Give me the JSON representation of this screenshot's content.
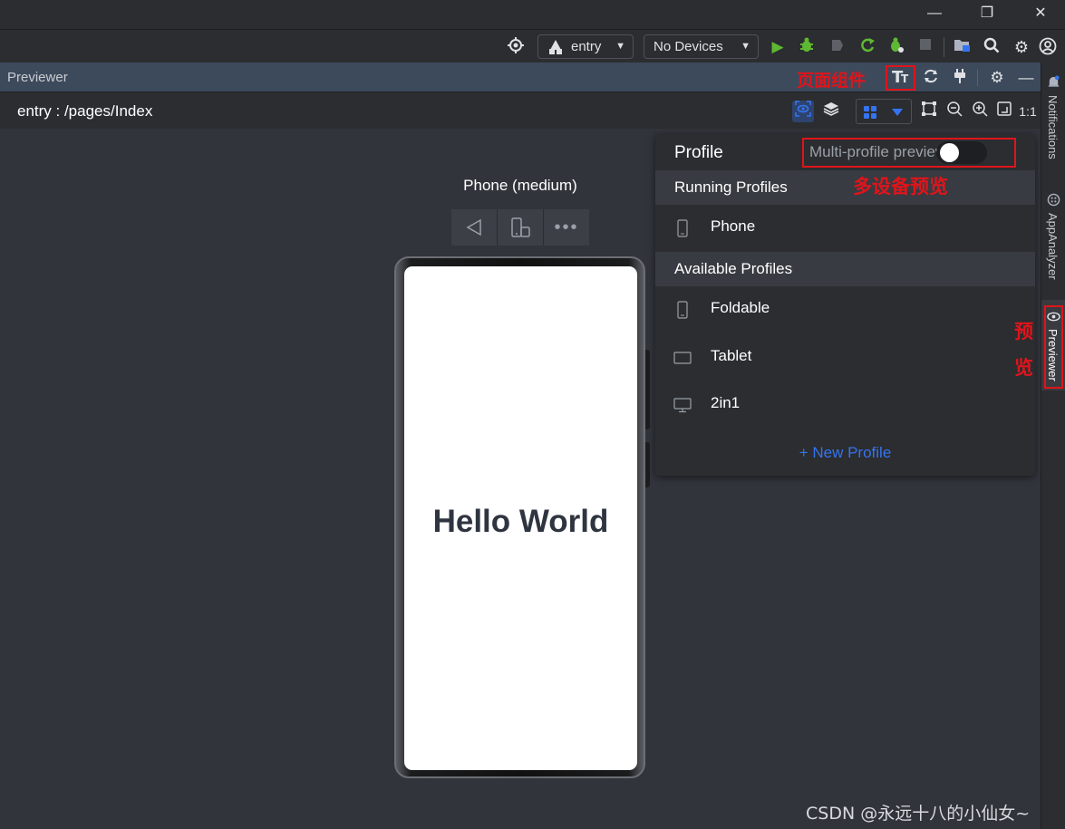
{
  "window": {
    "minimize": "—",
    "restore": "❐",
    "close": "✕"
  },
  "toolbar": {
    "run_config": "entry",
    "device_selector": "No Devices"
  },
  "previewer": {
    "title": "Previewer",
    "path": "entry : /pages/Index"
  },
  "annotations": {
    "page_component": "页面组件",
    "multi_device_preview": "多设备预览",
    "preview_char1": "预",
    "preview_char2": "览"
  },
  "device": {
    "label": "Phone (medium)",
    "content_text": "Hello World"
  },
  "profile_panel": {
    "title": "Profile",
    "multi_profile_label": "Multi-profile preview",
    "multi_profile_enabled": false,
    "running_header": "Running Profiles",
    "running": [
      {
        "label": "Phone",
        "icon": "phone-icon"
      }
    ],
    "available_header": "Available Profiles",
    "available": [
      {
        "label": "Foldable",
        "icon": "phone-icon"
      },
      {
        "label": "Tablet",
        "icon": "tablet-icon"
      },
      {
        "label": "2in1",
        "icon": "monitor-icon"
      }
    ],
    "new_profile": "+ New Profile"
  },
  "right_sidebar": {
    "tabs": [
      "Notifications",
      "AppAnalyzer",
      "Previewer"
    ]
  },
  "watermark": "CSDN @永远十八的小仙女~",
  "colors": {
    "accent_blue": "#3574f0",
    "annotation_red": "#e0141b",
    "run_green": "#5fb832"
  }
}
